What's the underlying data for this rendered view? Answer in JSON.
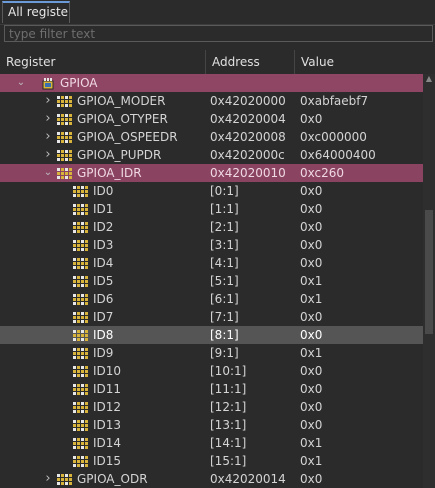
{
  "tab": {
    "label": "All registers"
  },
  "filter": {
    "placeholder": "type filter text"
  },
  "columns": {
    "register": "Register",
    "address": "Address",
    "value": "Value"
  },
  "rows": [
    {
      "level": 0,
      "kind": "peripheral",
      "expand": "expanded",
      "name": "GPIOA",
      "address": "",
      "value": "",
      "style": "group"
    },
    {
      "level": 1,
      "kind": "register",
      "expand": "collapsed",
      "name": "GPIOA_MODER",
      "address": "0x42020000",
      "value": "0xabfaebf7",
      "style": ""
    },
    {
      "level": 1,
      "kind": "register",
      "expand": "collapsed",
      "name": "GPIOA_OTYPER",
      "address": "0x42020004",
      "value": "0x0",
      "style": ""
    },
    {
      "level": 1,
      "kind": "register",
      "expand": "collapsed",
      "name": "GPIOA_OSPEEDR",
      "address": "0x42020008",
      "value": "0xc000000",
      "style": ""
    },
    {
      "level": 1,
      "kind": "register",
      "expand": "collapsed",
      "name": "GPIOA_PUPDR",
      "address": "0x4202000c",
      "value": "0x64000400",
      "style": ""
    },
    {
      "level": 1,
      "kind": "register",
      "expand": "expanded",
      "name": "GPIOA_IDR",
      "address": "0x42020010",
      "value": "0xc260",
      "style": "group-sub"
    },
    {
      "level": 2,
      "kind": "field",
      "expand": "none",
      "name": "ID0",
      "address": "[0:1]",
      "value": "0x0",
      "style": ""
    },
    {
      "level": 2,
      "kind": "field",
      "expand": "none",
      "name": "ID1",
      "address": "[1:1]",
      "value": "0x0",
      "style": ""
    },
    {
      "level": 2,
      "kind": "field",
      "expand": "none",
      "name": "ID2",
      "address": "[2:1]",
      "value": "0x0",
      "style": ""
    },
    {
      "level": 2,
      "kind": "field",
      "expand": "none",
      "name": "ID3",
      "address": "[3:1]",
      "value": "0x0",
      "style": ""
    },
    {
      "level": 2,
      "kind": "field",
      "expand": "none",
      "name": "ID4",
      "address": "[4:1]",
      "value": "0x0",
      "style": ""
    },
    {
      "level": 2,
      "kind": "field",
      "expand": "none",
      "name": "ID5",
      "address": "[5:1]",
      "value": "0x1",
      "style": ""
    },
    {
      "level": 2,
      "kind": "field",
      "expand": "none",
      "name": "ID6",
      "address": "[6:1]",
      "value": "0x1",
      "style": ""
    },
    {
      "level": 2,
      "kind": "field",
      "expand": "none",
      "name": "ID7",
      "address": "[7:1]",
      "value": "0x0",
      "style": ""
    },
    {
      "level": 2,
      "kind": "field",
      "expand": "none",
      "name": "ID8",
      "address": "[8:1]",
      "value": "0x0",
      "style": "selected"
    },
    {
      "level": 2,
      "kind": "field",
      "expand": "none",
      "name": "ID9",
      "address": "[9:1]",
      "value": "0x1",
      "style": ""
    },
    {
      "level": 2,
      "kind": "field",
      "expand": "none",
      "name": "ID10",
      "address": "[10:1]",
      "value": "0x0",
      "style": ""
    },
    {
      "level": 2,
      "kind": "field",
      "expand": "none",
      "name": "ID11",
      "address": "[11:1]",
      "value": "0x0",
      "style": ""
    },
    {
      "level": 2,
      "kind": "field",
      "expand": "none",
      "name": "ID12",
      "address": "[12:1]",
      "value": "0x0",
      "style": ""
    },
    {
      "level": 2,
      "kind": "field",
      "expand": "none",
      "name": "ID13",
      "address": "[13:1]",
      "value": "0x0",
      "style": ""
    },
    {
      "level": 2,
      "kind": "field",
      "expand": "none",
      "name": "ID14",
      "address": "[14:1]",
      "value": "0x1",
      "style": ""
    },
    {
      "level": 2,
      "kind": "field",
      "expand": "none",
      "name": "ID15",
      "address": "[15:1]",
      "value": "0x1",
      "style": ""
    },
    {
      "level": 1,
      "kind": "register",
      "expand": "collapsed",
      "name": "GPIOA_ODR",
      "address": "0x42020014",
      "value": "0x0",
      "style": ""
    }
  ],
  "colors": {
    "group_row": "#8f4564",
    "selected_row": "#555555",
    "background": "#2b2b2b",
    "icon_gold": "#d9b43a"
  }
}
